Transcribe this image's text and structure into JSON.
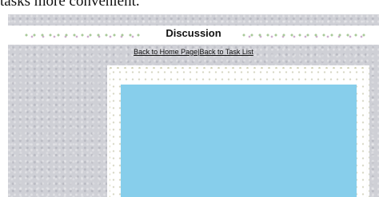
{
  "caption": "tasks more convenient.",
  "header": {
    "title": "Discussion"
  },
  "nav": {
    "home_link": "Back to Home Page",
    "separator": "|",
    "task_link": "Back to Task List"
  },
  "colors": {
    "page_background": "#cfd0d6",
    "content_panel": "#87ceeb",
    "title_bar": "#ffffff"
  }
}
